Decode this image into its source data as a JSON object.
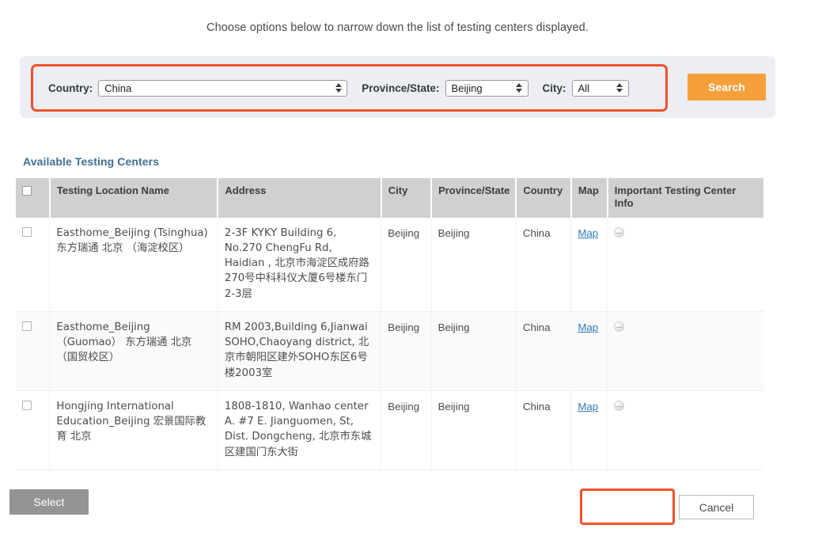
{
  "intro": {
    "text": "Choose options below to narrow down the list of testing centers displayed."
  },
  "filters": {
    "country_label": "Country:",
    "country_value": "China",
    "province_label": "Province/State:",
    "province_value": "Beijing",
    "city_label": "City:",
    "city_value": "All",
    "search_label": "Search",
    "highlight_color": "#f0512c",
    "search_button_color": "#f6a03c",
    "panel_color": "#eceef3"
  },
  "section": {
    "title": "Available Testing Centers",
    "title_color": "#3f7094"
  },
  "table": {
    "header_bg": "#d0d0d0",
    "columns": [
      {
        "key": "select",
        "label": ""
      },
      {
        "key": "name",
        "label": "Testing Location Name"
      },
      {
        "key": "address",
        "label": "Address"
      },
      {
        "key": "city",
        "label": "City"
      },
      {
        "key": "province",
        "label": "Province/State"
      },
      {
        "key": "country",
        "label": "Country"
      },
      {
        "key": "map",
        "label": "Map"
      },
      {
        "key": "info",
        "label": "Important Testing Center Info"
      }
    ],
    "map_link_label": "Map",
    "map_link_color": "#2b7bb9",
    "rows": [
      {
        "name": "Easthome_Beijing (Tsinghua) 东方瑞通 北京 （海淀校区）",
        "address": "2-3F KYKY Building 6, No.270 ChengFu Rd, Haidian , 北京市海淀区成府路270号中科科仪大厦6号楼东门2-3层",
        "city": "Beijing",
        "province": "Beijing",
        "country": "China",
        "map": "Map",
        "info": ""
      },
      {
        "name": "Easthome_Beijing（Guomao） 东方瑞通 北京（国贸校区）",
        "address": "RM 2003,Building 6,Jianwai SOHO,Chaoyang district, 北京市朝阳区建外SOHO东区6号楼2003室",
        "city": "Beijing",
        "province": "Beijing",
        "country": "China",
        "map": "Map",
        "info": ""
      },
      {
        "name": "Hongjing International Education_Beijing 宏景国际教育 北京",
        "address": "1808-1810, Wanhao center A. #7 E. Jianguomen, St, Dist. Dongcheng, 北京市东城区建国门东大街",
        "city": "Beijing",
        "province": "Beijing",
        "country": "China",
        "map": "Map",
        "info": ""
      }
    ]
  },
  "footer": {
    "select_label": "Select",
    "cancel_label": "Cancel",
    "select_bg": "#949494",
    "select_highlight": "#f0512c"
  }
}
